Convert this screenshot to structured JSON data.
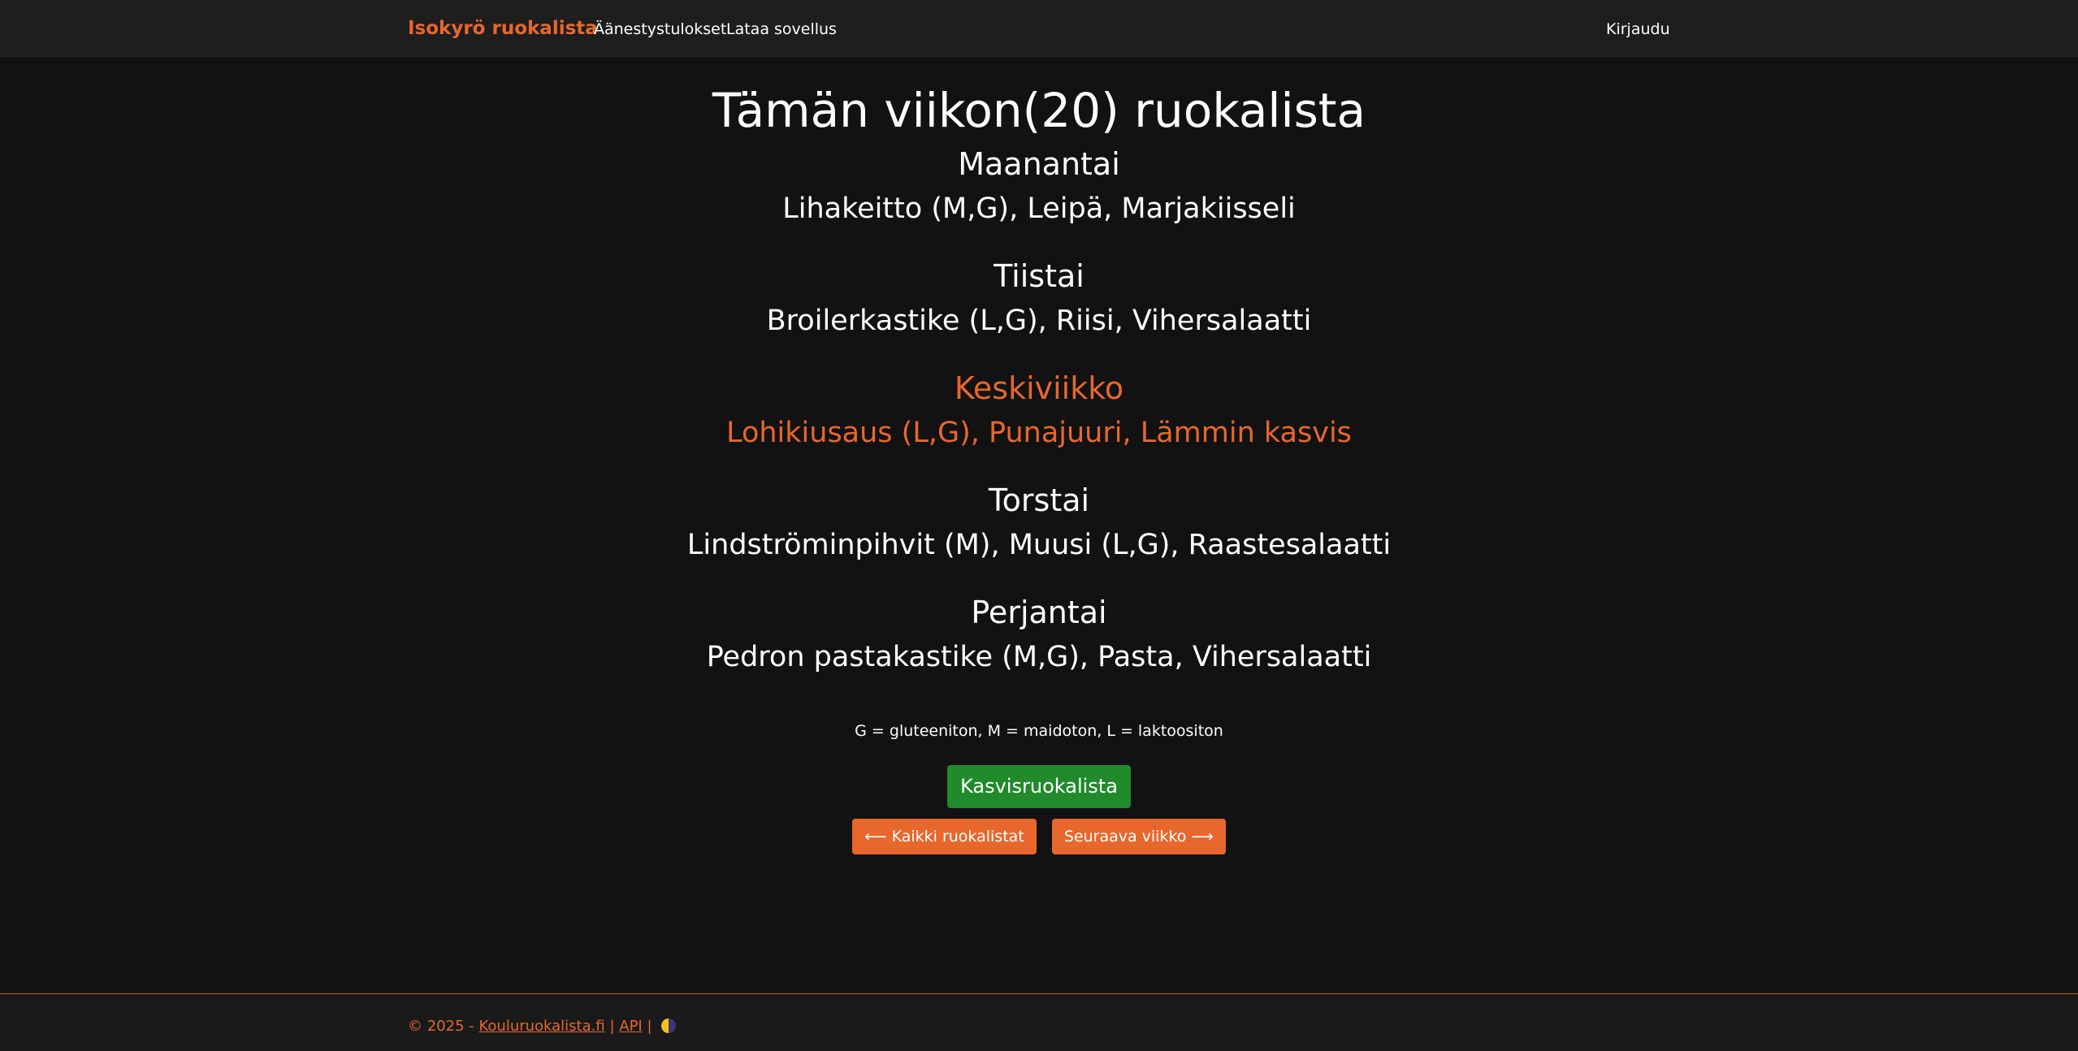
{
  "navbar": {
    "brand": "Isokyrö ruokalista",
    "links": [
      "Äänestystulokset",
      "Lataa sovellus"
    ],
    "login": "Kirjaudu"
  },
  "main": {
    "title": "Tämän viikon(20) ruokalista",
    "days": [
      {
        "name": "Maanantai",
        "menu": "Lihakeitto (M,G), Leipä, Marjakiisseli"
      },
      {
        "name": "Tiistai",
        "menu": "Broilerkastike (L,G), Riisi, Vihersalaatti"
      },
      {
        "name": "Keskiviikko",
        "menu": "Lohikiusaus (L,G), Punajuuri, Lämmin kasvis"
      },
      {
        "name": "Torstai",
        "menu": "Lindströminpihvit (M), Muusi (L,G), Raastesalaatti"
      },
      {
        "name": "Perjantai",
        "menu": "Pedron pastakastike (M,G), Pasta, Vihersalaatti"
      }
    ],
    "legend": "G = gluteeniton, M = maidoton, L = laktoositon",
    "veg_button": "Kasvisruokalista",
    "prev_button": "⟵ Kaikki ruokalistat",
    "next_button": "Seuraava viikko ⟶"
  },
  "footer": {
    "copyright": "© 2025 -",
    "site_link": "Kouluruokalista.fi",
    "separator": "|",
    "api_link": "API"
  },
  "colors": {
    "accent": "#e8672c",
    "green": "#218a2b",
    "background": "#121212"
  },
  "icons": {
    "theme_toggle": "theme-toggle-icon"
  }
}
